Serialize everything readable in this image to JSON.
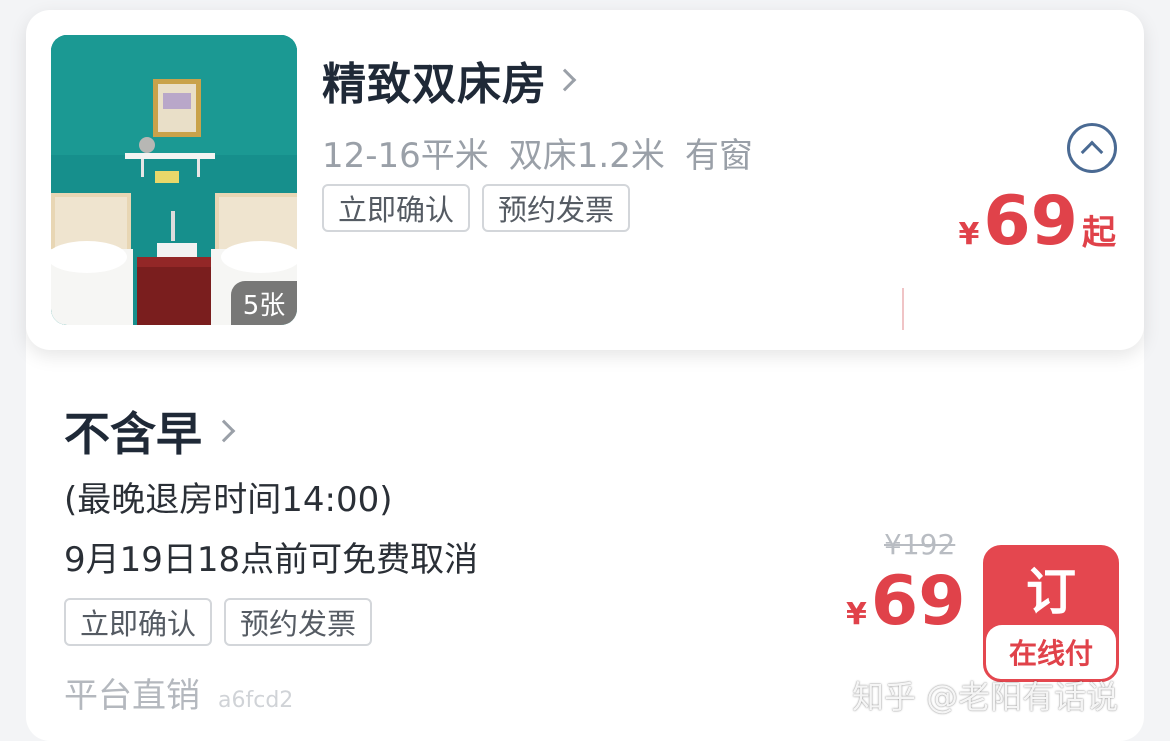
{
  "room": {
    "title": "精致双床房",
    "specs": [
      "12-16平米",
      "双床1.2米",
      "有窗"
    ],
    "tags": [
      "立即确认",
      "预约发票"
    ],
    "photo_count": "5张",
    "price_currency": "¥",
    "price_value": "69",
    "price_suffix": "起"
  },
  "plan": {
    "title": "不含早",
    "checkout": "(最晚退房时间14:00)",
    "cancel_policy": "9月19日18点前可免费取消",
    "tags": [
      "立即确认",
      "预约发票"
    ],
    "seller": "平台直销",
    "seller_code": "a6fcd2",
    "original_price": "¥192",
    "price_currency": "¥",
    "price_value": "69",
    "book_label": "订",
    "pay_label": "在线付"
  },
  "watermark": "知乎 @老阳有话说",
  "colors": {
    "accent_red": "#e0424a",
    "text_dark": "#1f2937",
    "text_gray": "#9aa0a8",
    "collapse_blue": "#4a6a93"
  },
  "icons": {
    "title_chevron": "chevron-right-icon",
    "collapse": "chevron-up-circle-icon"
  }
}
